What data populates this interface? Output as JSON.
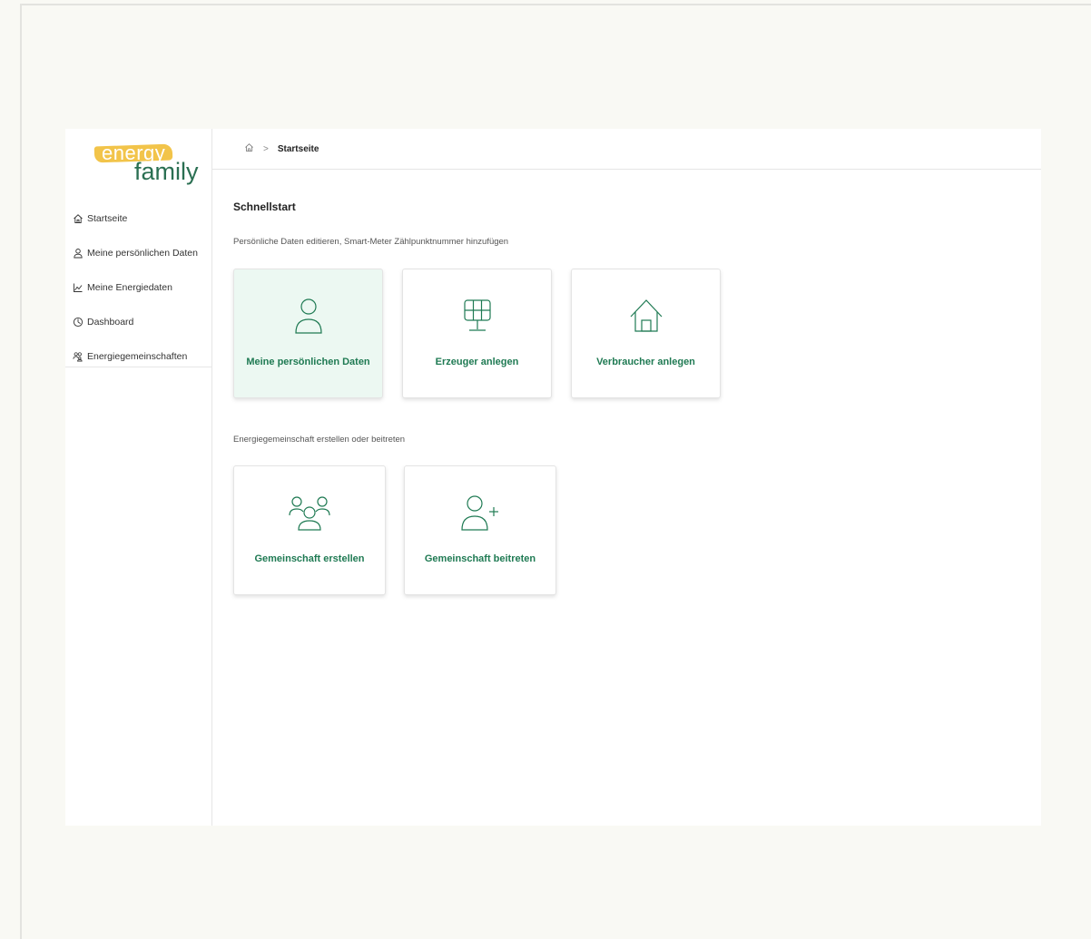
{
  "logo": {
    "line1": "energy",
    "line2": "family"
  },
  "sidebar": {
    "items": [
      {
        "label": "Startseite",
        "icon": "home-icon"
      },
      {
        "label": "Meine persönlichen Daten",
        "icon": "user-icon"
      },
      {
        "label": "Meine Energiedaten",
        "icon": "chart-line-icon"
      },
      {
        "label": "Dashboard",
        "icon": "dashboard-icon"
      },
      {
        "label": "Energiegemeinschaften",
        "icon": "community-icon"
      }
    ]
  },
  "breadcrumb": {
    "home_icon": "home-icon",
    "current": "Startseite"
  },
  "main": {
    "heading": "Schnellstart",
    "section1": {
      "subtitle": "Persönliche Daten editieren, Smart-Meter Zählpunktnummer hinzufügen",
      "cards": [
        {
          "label": "Meine persönlichen Daten",
          "icon": "user-icon"
        },
        {
          "label": "Erzeuger anlegen",
          "icon": "solar-panel-icon"
        },
        {
          "label": "Verbraucher anlegen",
          "icon": "house-icon"
        }
      ]
    },
    "section2": {
      "subtitle": "Energiegemeinschaft erstellen oder beitreten",
      "cards": [
        {
          "label": "Gemeinschaft erstellen",
          "icon": "group-icon"
        },
        {
          "label": "Gemeinschaft beitreten",
          "icon": "user-plus-icon"
        }
      ]
    }
  },
  "colors": {
    "accent": "#1f7a53",
    "logo_yellow": "#f2c44a",
    "active_card_bg": "#ecf8f2",
    "page_bg": "#f9f9f4"
  }
}
